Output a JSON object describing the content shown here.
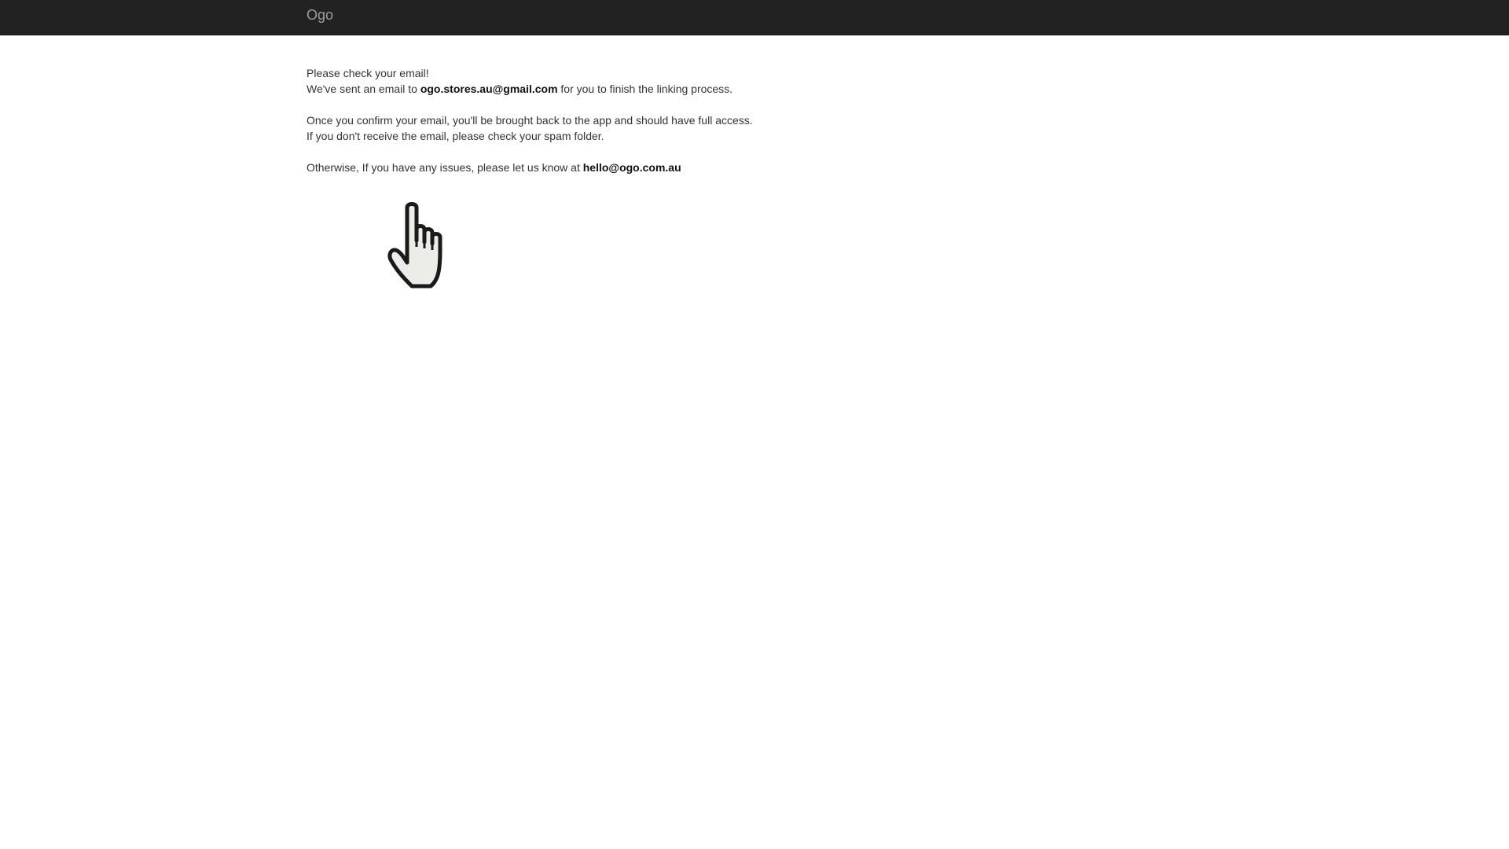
{
  "navbar": {
    "brand": "Ogo"
  },
  "message": {
    "line1": "Please check your email!",
    "line2_prefix": "We've sent an email to",
    "line2_email": "ogo.stores.au@gmail.com",
    "line2_suffix": "for you to finish the linking process.",
    "line3": "Once you confirm your email, you'll be brought back to the app and should have full access.",
    "line4": "If you don't receive the email, please check your spam folder.",
    "line5_prefix": "Otherwise, If you have any issues, please let us know at",
    "line5_email": "hello@ogo.com.au"
  },
  "colors": {
    "navbar_bg": "#222222",
    "brand_text": "#9d9d9d",
    "body_text": "#333333"
  },
  "icons": {
    "cursor": "hand-pointer-icon"
  }
}
